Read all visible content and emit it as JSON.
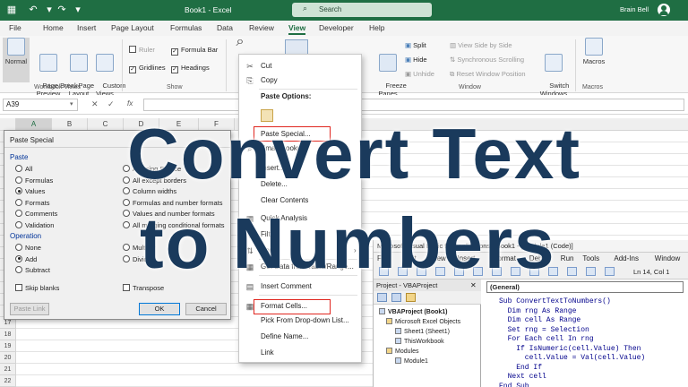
{
  "titlebar": {
    "doc_title": "Book1 - Excel",
    "search_placeholder": "Search",
    "user": "Brain Bell"
  },
  "ribbon_tabs": [
    "File",
    "Home",
    "Insert",
    "Page Layout",
    "Formulas",
    "Data",
    "Review",
    "View",
    "Developer",
    "Help"
  ],
  "active_tab": "View",
  "ribbon": {
    "workbook_views": {
      "buttons": [
        "Normal",
        "Page Break\nPreview",
        "Page\nLayout",
        "Custom\nViews"
      ],
      "label": "Workbook Views"
    },
    "show": {
      "ruler": "Ruler",
      "formula_bar": "Formula Bar",
      "gridlines": "Gridlines",
      "headings": "Headings",
      "label": "Show"
    },
    "window": {
      "freeze": "Freeze\nPanes",
      "split": "Split",
      "hide": "Hide",
      "unhide": "Unhide",
      "side_by_side": "View Side by Side",
      "sync_scroll": "Synchronous Scrolling",
      "reset_pos": "Reset Window Position",
      "switch": "Switch\nWindows",
      "label": "Window"
    },
    "macros": {
      "button": "Macros",
      "label": "Macros"
    }
  },
  "formula_bar": {
    "name_box": "A39",
    "fx": "fx"
  },
  "columns": [
    "A",
    "B",
    "C",
    "D",
    "E",
    "F"
  ],
  "rows": [
    "1",
    "2",
    "3",
    "4",
    "5",
    "6",
    "7",
    "8",
    "9",
    "10",
    "11",
    "12",
    "13",
    "14",
    "15",
    "16",
    "17",
    "18",
    "19",
    "20",
    "21",
    "22"
  ],
  "paste_special": {
    "title": "Paste Special",
    "paste_label": "Paste",
    "paste_left": [
      "All",
      "Formulas",
      "Values",
      "Formats",
      "Comments",
      "Validation"
    ],
    "paste_right": [
      "All using Source",
      "All except borders",
      "Column widths",
      "Formulas and number formats",
      "Values and number formats",
      "All merging conditional formats"
    ],
    "selected": "Values",
    "operation_label": "Operation",
    "op_left": [
      "None",
      "Add",
      "Subtract"
    ],
    "op_right": [
      "Multiply",
      "Divide"
    ],
    "op_selected": "Add",
    "skip_blanks": "Skip blanks",
    "transpose": "Transpose",
    "paste_link": "Paste Link",
    "ok": "OK",
    "cancel": "Cancel"
  },
  "context_menu": {
    "items": [
      "Cut",
      "Copy",
      "Paste Options:",
      "Paste Special...",
      "Smart Lookup",
      "Insert...",
      "Delete...",
      "Clear Contents",
      "Quick Analysis",
      "Filter",
      "Sort",
      "Get Data from Table/Range...",
      "Insert Comment",
      "Format Cells...",
      "Pick From Drop-down List...",
      "Define Name...",
      "Link"
    ]
  },
  "vbe": {
    "title": "Microsoft Visual Basic for Applications - Book1 - [Module1 (Code)]",
    "menu": [
      "File",
      "Edit",
      "View",
      "Insert",
      "Format",
      "Debug",
      "Run",
      "Tools",
      "Add-Ins",
      "Window",
      "Help"
    ],
    "position": "Ln 14, Col 1",
    "project_title": "Project - VBAProject",
    "tree": [
      "VBAProject (Book1)",
      "Microsoft Excel Objects",
      "Sheet1 (Sheet1)",
      "ThisWorkbook",
      "Modules",
      "Module1"
    ],
    "combo": "(General)",
    "code": [
      "Sub ConvertTextToNumbers()",
      "  Dim rng As Range",
      "  Dim cell As Range",
      "  Set rng = Selection",
      "  For Each cell In rng",
      "    If IsNumeric(cell.Value) Then",
      "      cell.Value = Val(cell.Value)",
      "    End If",
      "  Next cell",
      "End Sub"
    ]
  },
  "headline": {
    "line1": "Convert Text",
    "line2": "to Numbers"
  }
}
